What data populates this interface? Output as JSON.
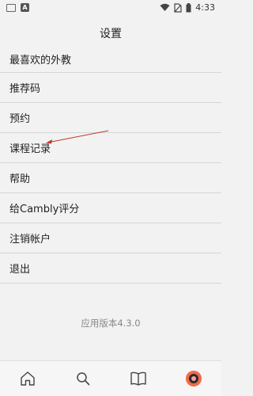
{
  "status_bar": {
    "time": "4:33",
    "icon_a_label": "A"
  },
  "header": {
    "title": "设置"
  },
  "menu": {
    "items": [
      {
        "label": "最喜欢的外教"
      },
      {
        "label": "推荐码"
      },
      {
        "label": "预约"
      },
      {
        "label": "课程记录"
      },
      {
        "label": "帮助"
      },
      {
        "label": "给Cambly评分"
      },
      {
        "label": "注销帐户"
      },
      {
        "label": "退出"
      }
    ]
  },
  "version": "应用版本4.3.0",
  "tabbar": {
    "tabs": [
      {
        "icon": "home-icon"
      },
      {
        "icon": "search-icon"
      },
      {
        "icon": "book-icon"
      },
      {
        "icon": "profile-icon",
        "active": true
      }
    ]
  },
  "colors": {
    "accent": "#f26a4b",
    "annotation": "#c0392b"
  }
}
